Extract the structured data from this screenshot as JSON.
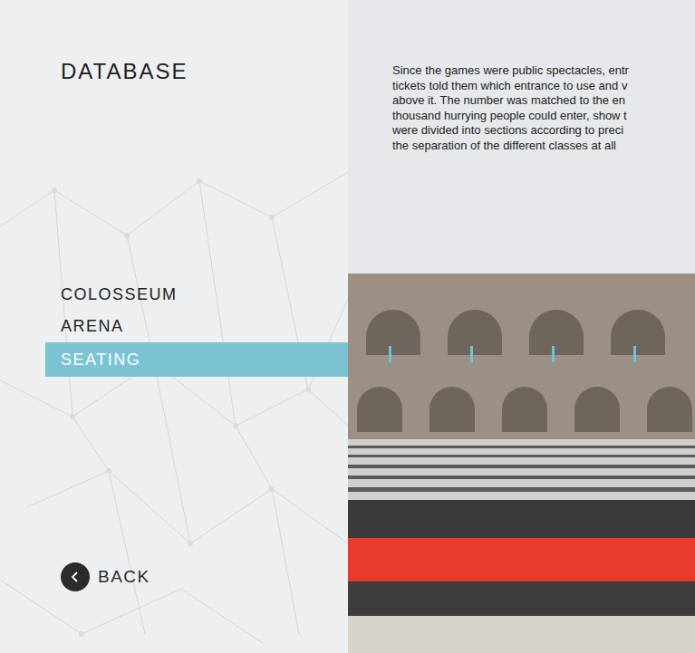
{
  "title": "DATABASE",
  "menu": [
    {
      "label": "COLOSSEUM",
      "selected": false
    },
    {
      "label": "ARENA",
      "selected": false
    },
    {
      "label": "SEATING",
      "selected": true
    }
  ],
  "back": {
    "label": "BACK"
  },
  "article": {
    "lines": [
      "Since the games were public spectacles, entr",
      "tickets told them which entrance to use and v",
      "above it. The number was matched to the en",
      "thousand hurrying people could enter, show t",
      "were divided into sections according to preci",
      "the separation of the different classes at all"
    ]
  }
}
